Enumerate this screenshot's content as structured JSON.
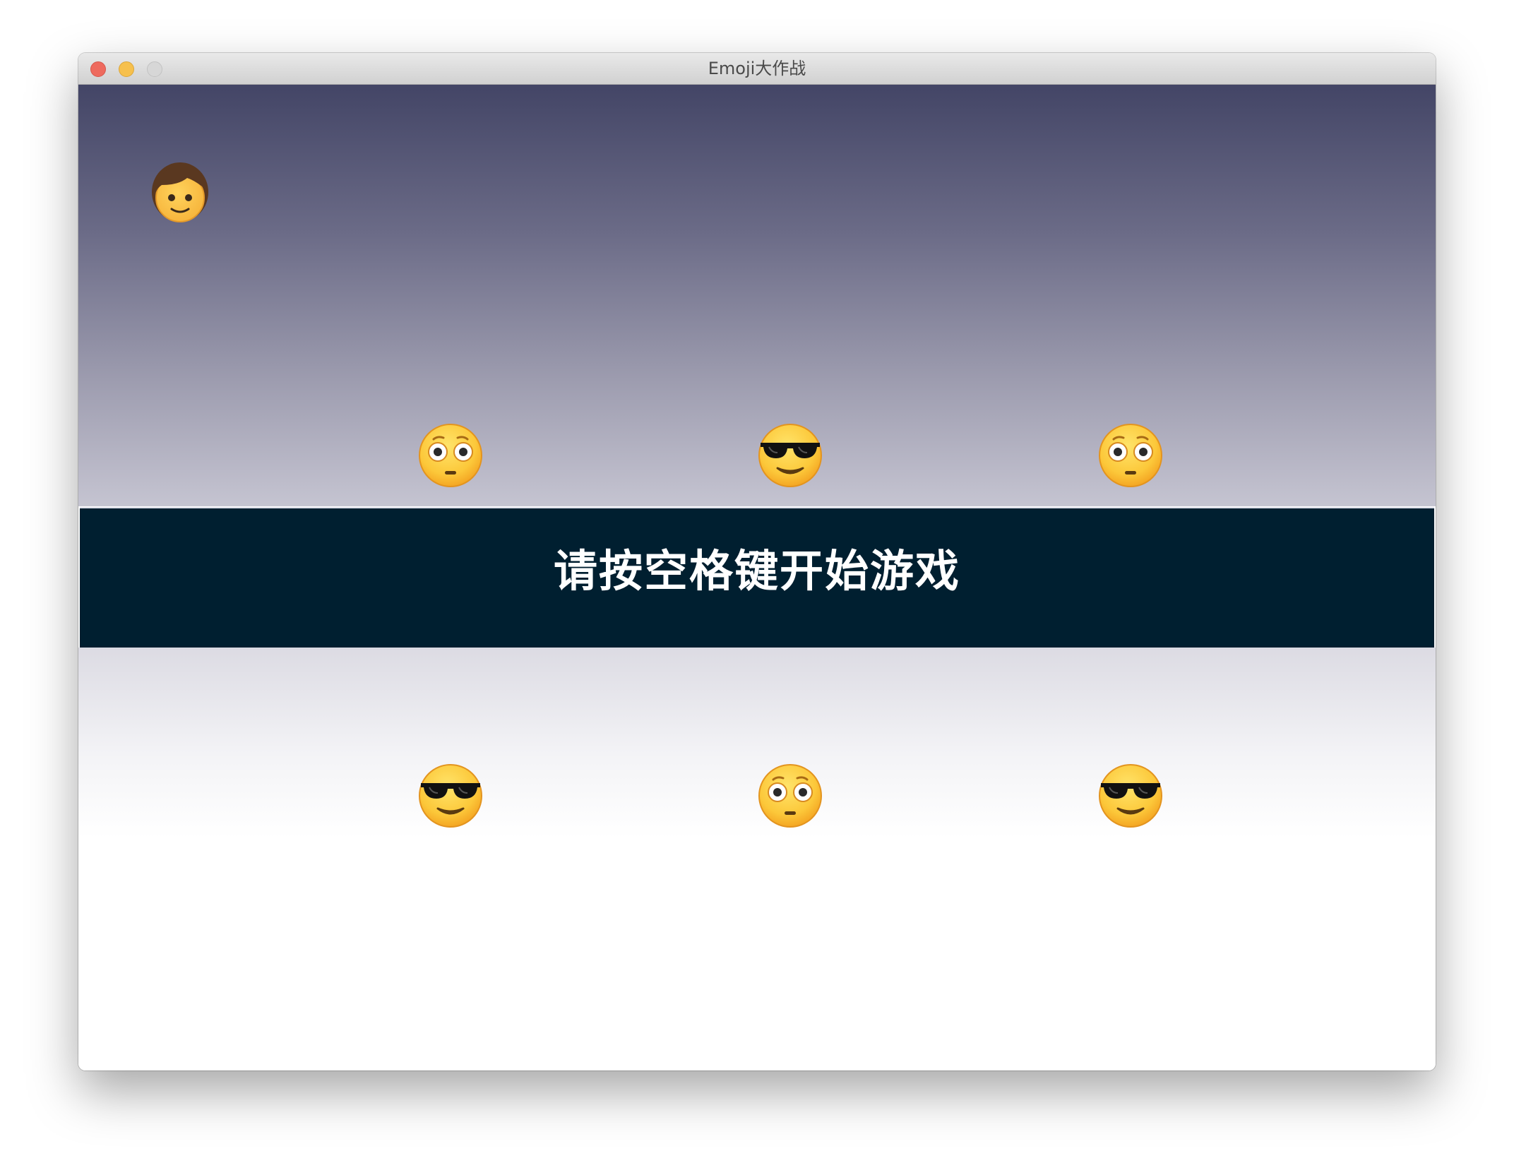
{
  "window": {
    "title": "Emoji大作战"
  },
  "banner": {
    "text": "请按空格键开始游戏"
  },
  "player": {
    "icon": "person-emoji-icon"
  },
  "emojis_top_row": [
    {
      "icon": "flushed-face-icon"
    },
    {
      "icon": "sunglasses-face-icon"
    },
    {
      "icon": "flushed-face-icon"
    }
  ],
  "emojis_bottom_row": [
    {
      "icon": "sunglasses-face-icon"
    },
    {
      "icon": "flushed-face-icon"
    },
    {
      "icon": "sunglasses-face-icon"
    }
  ],
  "colors": {
    "banner_bg": "#001f30",
    "sky_top": "#434566",
    "sky_bottom": "#c5c4d1",
    "close": "#ee6a5e",
    "minimize": "#f6c04d",
    "maximize": "#d7d7d7"
  }
}
